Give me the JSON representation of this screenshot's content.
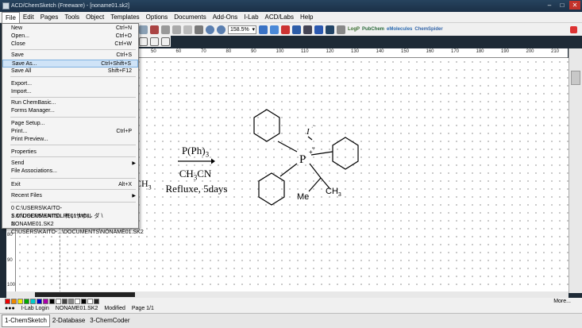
{
  "window": {
    "title": "ACD/ChemSketch (Freeware) - [noname01.sk2]"
  },
  "menubar": [
    "File",
    "Edit",
    "Pages",
    "Tools",
    "Object",
    "Templates",
    "Options",
    "Documents",
    "Add-Ons",
    "I-Lab",
    "ACD/Labs",
    "Help"
  ],
  "toolbar": {
    "zoom": "158.5%",
    "logp": "LogP",
    "pubchem": "PubChem",
    "emolecules": "eMolecules",
    "chemspider": "ChemSpider"
  },
  "file_menu": {
    "items": [
      {
        "label": "New",
        "shortcut": "Ctrl+N"
      },
      {
        "label": "Open...",
        "shortcut": "Ctrl+O"
      },
      {
        "label": "Close",
        "shortcut": "Ctrl+W"
      },
      {
        "label": "Save",
        "shortcut": "Ctrl+S"
      },
      {
        "label": "Save As...",
        "shortcut": "Ctrl+Shift+S"
      },
      {
        "label": "Save All",
        "shortcut": "Shift+F12"
      },
      {
        "label": "Export...",
        "shortcut": ""
      },
      {
        "label": "Import...",
        "shortcut": ""
      },
      {
        "label": "Run ChemBasic...",
        "shortcut": ""
      },
      {
        "label": "Forms Manager...",
        "shortcut": ""
      },
      {
        "label": "Page Setup...",
        "shortcut": ""
      },
      {
        "label": "Print...",
        "shortcut": "Ctrl+P"
      },
      {
        "label": "Print Preview...",
        "shortcut": ""
      },
      {
        "label": "Properties",
        "shortcut": ""
      },
      {
        "label": "Send",
        "shortcut": ""
      },
      {
        "label": "File Associations...",
        "shortcut": ""
      },
      {
        "label": "Exit",
        "shortcut": "Alt+X"
      },
      {
        "label": "Recent Files",
        "shortcut": ""
      },
      {
        "label": "0 C:\\USERS\\KAITO-S.M\\DOCUMENTS\\LPE01.MOL",
        "shortcut": ""
      },
      {
        "label": "1 C:\\USERS\\KAITO...れいサホル ダ \\ NONAME01.SK2",
        "shortcut": ""
      },
      {
        "label": "2 C:\\USERS\\KAITO-...\\DOCUMENTS\\NONAME01.SK2",
        "shortcut": ""
      }
    ]
  },
  "ruler_top": [
    "50",
    "60",
    "70",
    "80",
    "90",
    "100",
    "110",
    "120",
    "130",
    "140",
    "150",
    "160",
    "170",
    "180",
    "190",
    "200",
    "210"
  ],
  "ruler_left": [
    "80",
    "90",
    "100"
  ],
  "reaction": {
    "reagent": "P(Ph)3",
    "solvent": "CH3CN",
    "conditions": "Refluxe, 5days",
    "left_fragment": "CH3"
  },
  "molecule": {
    "center": "P",
    "charge": "+",
    "counterion": "I",
    "dots": "••",
    "me": "Me",
    "ch3": "CH3"
  },
  "palette": {
    "more": "More..."
  },
  "status": {
    "ilab": "I-Lab Login",
    "file": "NONAME01.SK2",
    "state": "Modified",
    "page": "Page 1/1"
  },
  "tabs": [
    "1-ChemSketch",
    "2-Database",
    "3-ChemCoder"
  ],
  "colors": {
    "menu_highlight": "#cfe3f7",
    "title_bar": "#1b3047"
  }
}
